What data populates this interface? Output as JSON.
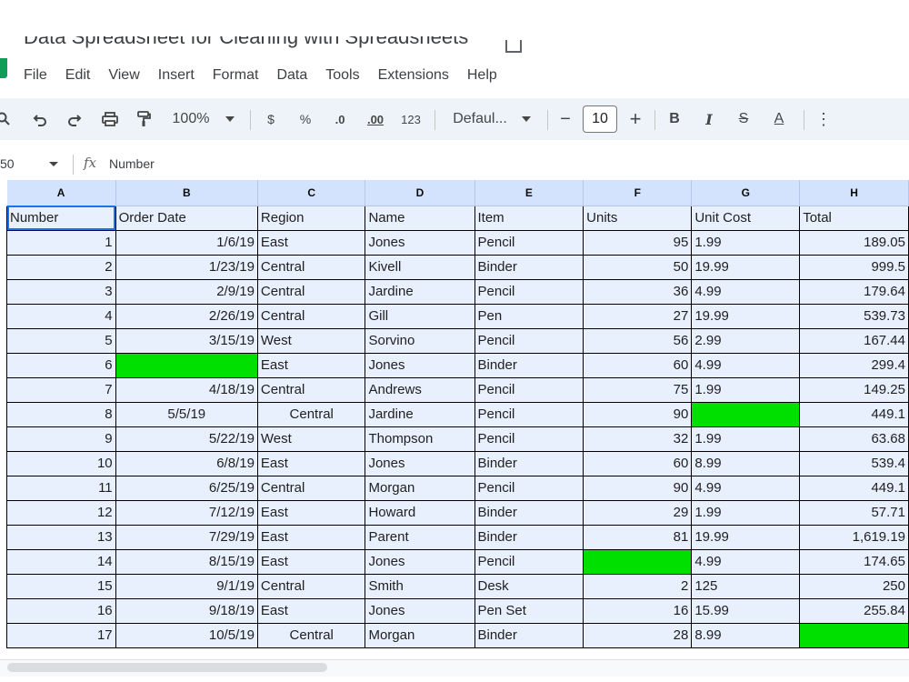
{
  "window": {
    "title": "Data Spreadsheet for  Cleaning with Spreadsheets"
  },
  "menu": [
    "File",
    "Edit",
    "View",
    "Insert",
    "Format",
    "Data",
    "Tools",
    "Extensions",
    "Help"
  ],
  "toolbar": {
    "zoom": "100%",
    "currency": "$",
    "percent": "%",
    "dec_decrease": ".0",
    "dec_increase": ".00",
    "number_format": "123",
    "font": "Defaul...",
    "minus": "−",
    "font_size": "10",
    "plus": "+",
    "bold": "B",
    "italic": "I",
    "strike": "S",
    "text_color": "A",
    "more": "⋮"
  },
  "formula_bar": {
    "name_box": "50",
    "fx": "fx",
    "content": "Number"
  },
  "columns": [
    "A",
    "B",
    "C",
    "D",
    "E",
    "F",
    "G",
    "H"
  ],
  "headers": [
    "Number",
    "Order Date",
    "Region",
    "Name",
    "Item",
    "Units",
    "Unit Cost",
    "Total"
  ],
  "rows": [
    [
      "1",
      "1/6/19",
      "East",
      "Jones",
      "Pencil",
      "95",
      "1.99",
      "189.05"
    ],
    [
      "2",
      "1/23/19",
      "Central",
      "Kivell",
      "Binder",
      "50",
      "19.99",
      "999.5"
    ],
    [
      "3",
      "2/9/19",
      "Central",
      "Jardine",
      "Pencil",
      "36",
      "4.99",
      "179.64"
    ],
    [
      "4",
      "2/26/19",
      "Central",
      "Gill",
      "Pen",
      "27",
      "19.99",
      "539.73"
    ],
    [
      "5",
      "3/15/19",
      "West",
      "Sorvino",
      "Pencil",
      "56",
      "2.99",
      "167.44"
    ],
    [
      "6",
      "",
      "East",
      "Jones",
      "Binder",
      "60",
      "4.99",
      "299.4"
    ],
    [
      "7",
      "4/18/19",
      "Central",
      "Andrews",
      "Pencil",
      "75",
      "1.99",
      "149.25"
    ],
    [
      "8",
      "5/5/19",
      "Central",
      "Jardine",
      "Pencil",
      "90",
      "",
      "449.1"
    ],
    [
      "9",
      "5/22/19",
      "West",
      "Thompson",
      "Pencil",
      "32",
      "1.99",
      "63.68"
    ],
    [
      "10",
      "6/8/19",
      "East",
      "Jones",
      "Binder",
      "60",
      "8.99",
      "539.4"
    ],
    [
      "11",
      "6/25/19",
      "Central",
      "Morgan",
      "Pencil",
      "90",
      "4.99",
      "449.1"
    ],
    [
      "12",
      "7/12/19",
      "East",
      "Howard",
      "Binder",
      "29",
      "1.99",
      "57.71"
    ],
    [
      "13",
      "7/29/19",
      "East",
      "Parent",
      "Binder",
      "81",
      "19.99",
      "1,619.19"
    ],
    [
      "14",
      "8/15/19",
      "East",
      "Jones",
      "Pencil",
      "",
      "4.99",
      "174.65"
    ],
    [
      "15",
      "9/1/19",
      "Central",
      "Smith",
      "Desk",
      "2",
      "125",
      "250"
    ],
    [
      "16",
      "9/18/19",
      "East",
      "Jones",
      "Pen Set",
      "16",
      "15.99",
      "255.84"
    ],
    [
      "17",
      "10/5/19",
      "Central",
      "Morgan",
      "Binder",
      "28",
      "8.99",
      ""
    ]
  ],
  "colors": {
    "highlight_green": "#00e000",
    "header_blue": "#d3e3fd",
    "selection_blue": "#e8f0fe"
  }
}
